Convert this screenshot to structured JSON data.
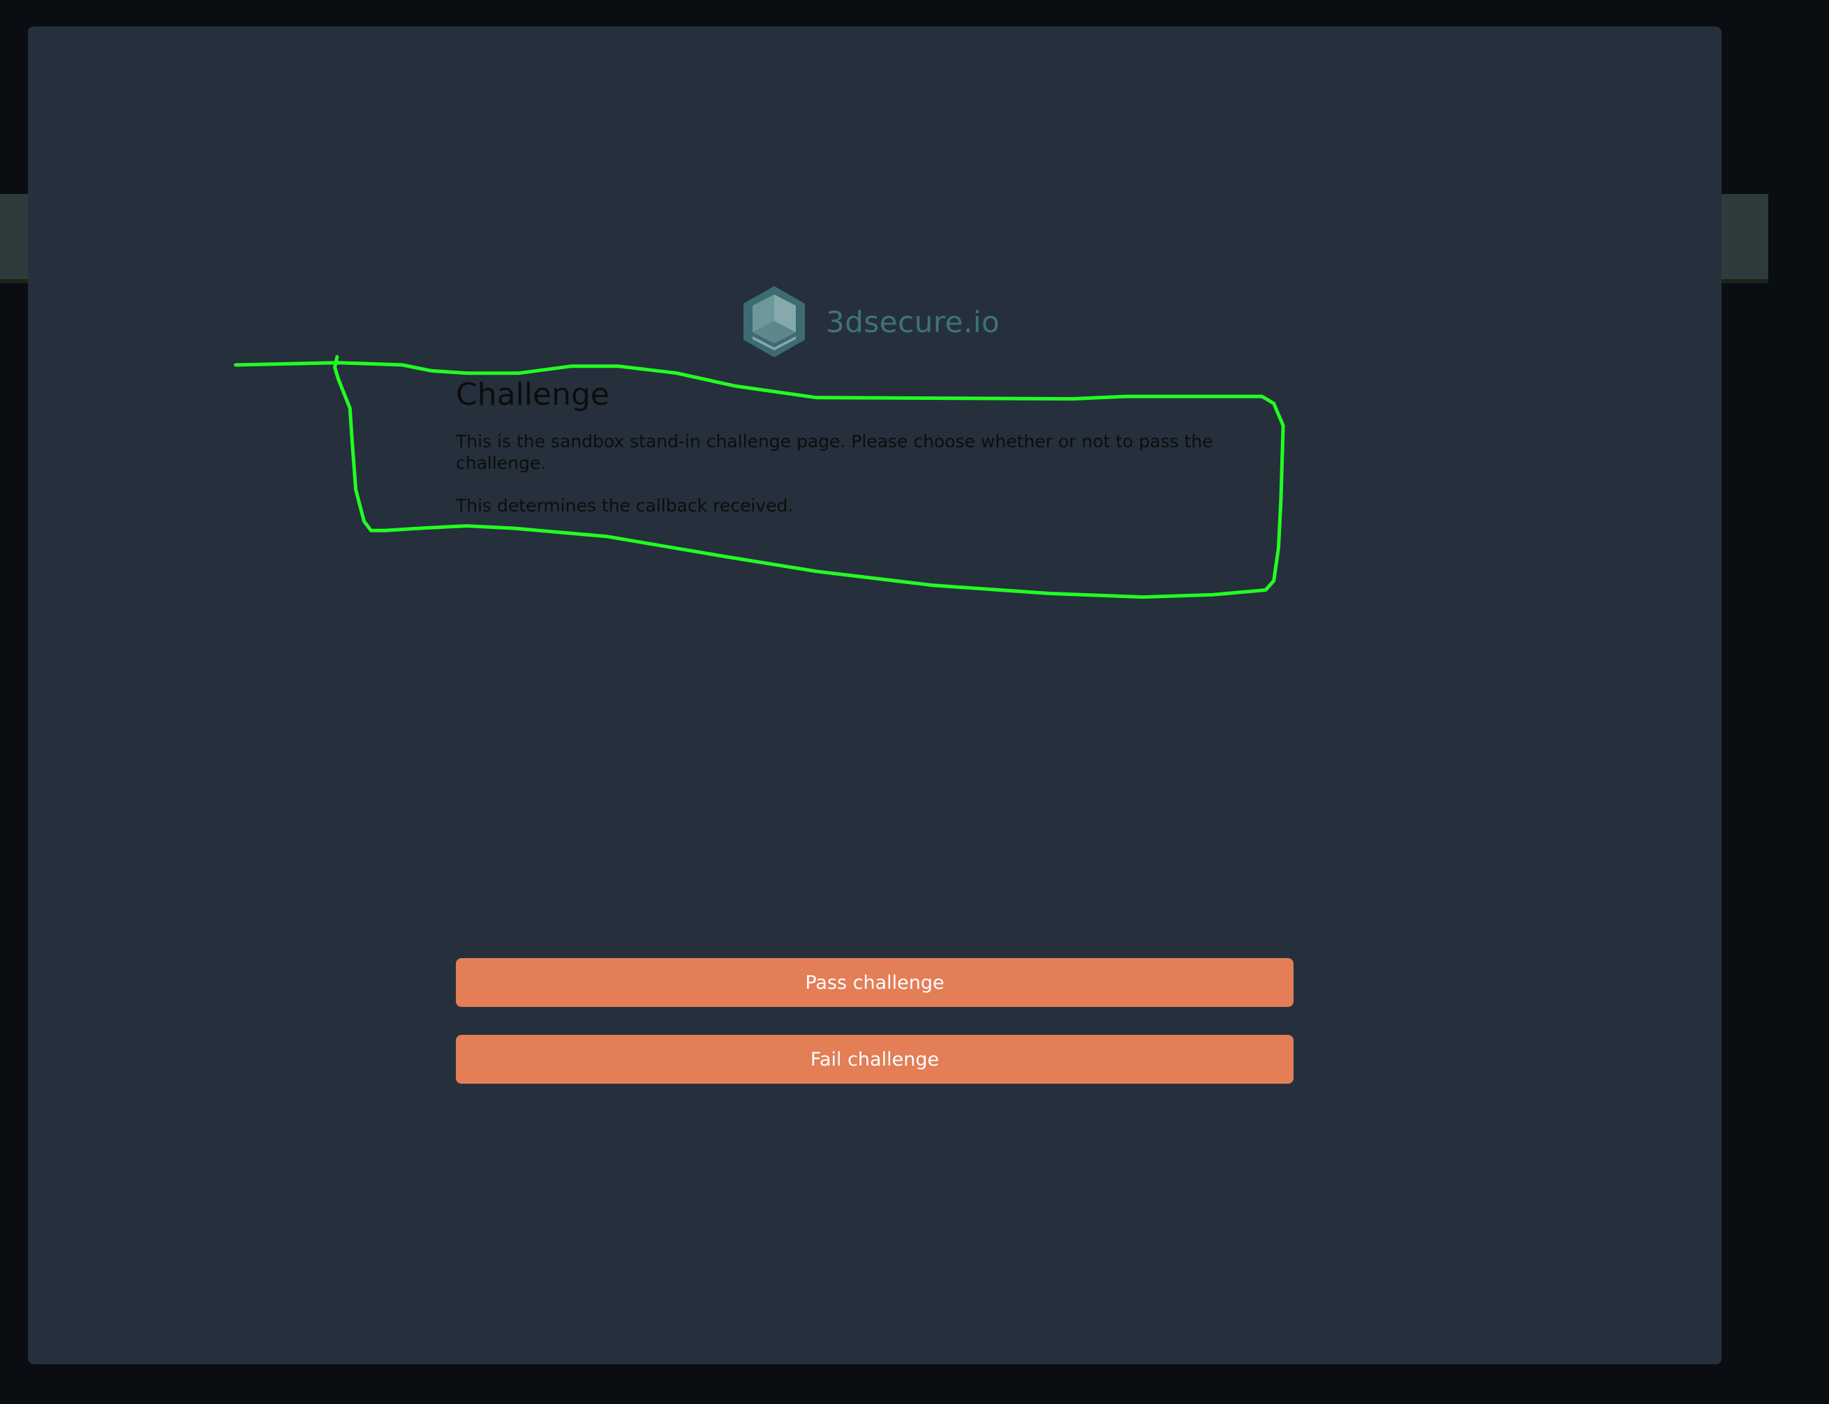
{
  "brand": {
    "name": "3dsecure.io",
    "icon": "hexagon-cube-logo",
    "color": "#3f727a"
  },
  "challenge": {
    "title": "Challenge",
    "paragraphs": [
      "This is the sandbox stand-in challenge page. Please choose whether or not to pass the challenge.",
      "This determines the callback received."
    ]
  },
  "actions": {
    "pass_label": "Pass challenge",
    "fail_label": "Fail challenge",
    "button_color": "#e37e57"
  },
  "annotation": {
    "color": "#22ff22"
  }
}
